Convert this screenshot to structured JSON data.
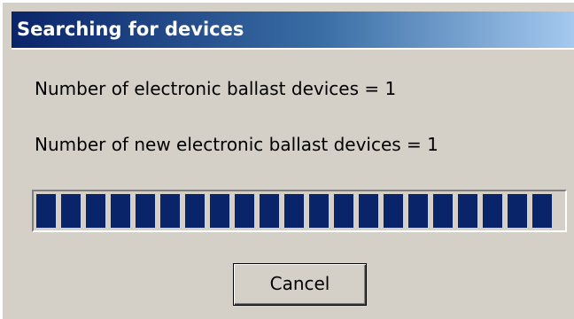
{
  "dialog": {
    "title": "Searching for devices",
    "device_count_text": "Number of electronic ballast devices = 1",
    "new_device_count_text": "Number of new electronic ballast devices = 1",
    "progress": {
      "fraction": 0.94,
      "filled_chunks": 21,
      "color": "#0a246a"
    },
    "cancel_label": "Cancel"
  },
  "colors": {
    "dialog_background": "#d4d0c8",
    "title_gradient_start": "#0a246a",
    "title_gradient_end": "#a6caf0",
    "title_text": "#ffffff"
  }
}
